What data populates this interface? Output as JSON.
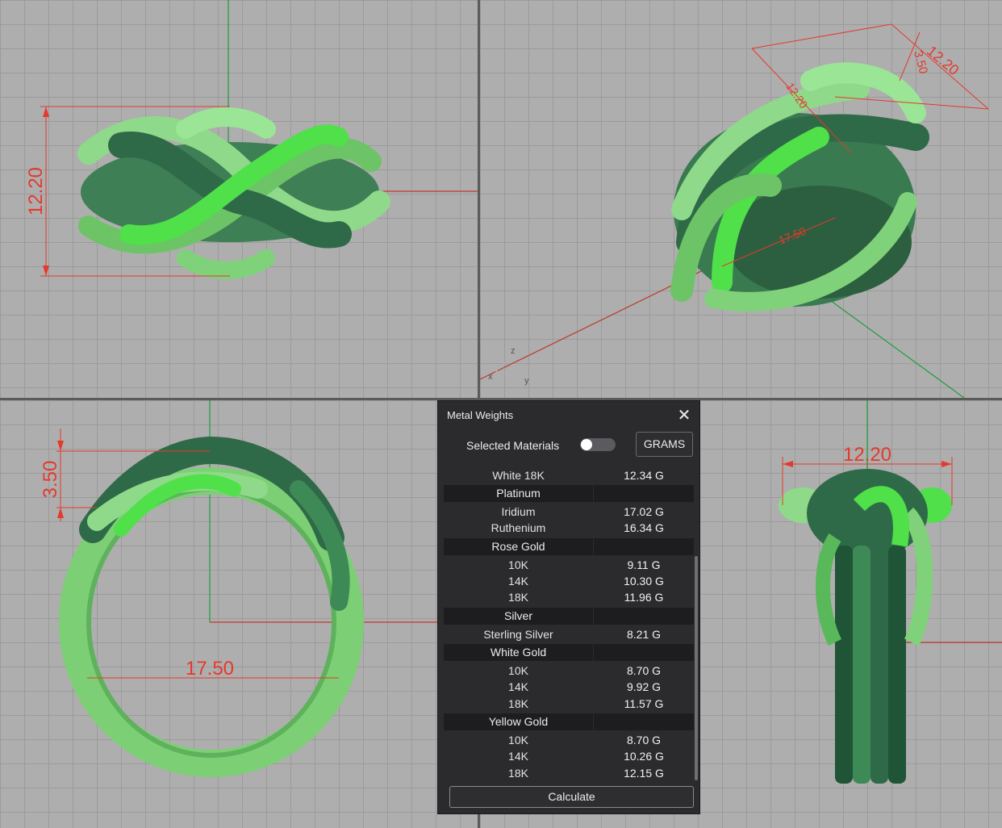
{
  "viewports": {
    "top": {
      "dimension_label": "12.20"
    },
    "perspective": {
      "dimension_labels": [
        "12.20",
        "3.50",
        "12.20",
        "17.50"
      ],
      "axis_labels": {
        "z": "z",
        "x": "x",
        "y": "y"
      }
    },
    "front": {
      "height_label": "3.50",
      "width_label": "17.50"
    },
    "right": {
      "dimension_label": "12.20"
    }
  },
  "ring_colors": {
    "dark": "#2f6a48",
    "mid": "#58b85a",
    "light": "#8fd98a",
    "bright": "#4fe04a"
  },
  "dimension_color": "#e4392c",
  "panel": {
    "title": "Metal Weights",
    "close_icon": "close-icon",
    "selected_materials_label": "Selected Materials",
    "selected_materials_on": false,
    "units_button": "GRAMS",
    "rows": [
      {
        "type": "item",
        "name": "White 18K",
        "weight": "12.34 G"
      },
      {
        "type": "group",
        "name": "Platinum",
        "weight": ""
      },
      {
        "type": "item",
        "name": "Iridium",
        "weight": "17.02 G"
      },
      {
        "type": "item",
        "name": "Ruthenium",
        "weight": "16.34 G"
      },
      {
        "type": "group",
        "name": "Rose Gold",
        "weight": ""
      },
      {
        "type": "item",
        "name": "10K",
        "weight": "9.11 G"
      },
      {
        "type": "item",
        "name": "14K",
        "weight": "10.30 G"
      },
      {
        "type": "item",
        "name": "18K",
        "weight": "11.96 G"
      },
      {
        "type": "group",
        "name": "Silver",
        "weight": ""
      },
      {
        "type": "item",
        "name": "Sterling Silver",
        "weight": "8.21 G"
      },
      {
        "type": "group",
        "name": "White Gold",
        "weight": ""
      },
      {
        "type": "item",
        "name": "10K",
        "weight": "8.70 G"
      },
      {
        "type": "item",
        "name": "14K",
        "weight": "9.92 G"
      },
      {
        "type": "item",
        "name": "18K",
        "weight": "11.57 G"
      },
      {
        "type": "group",
        "name": "Yellow Gold",
        "weight": ""
      },
      {
        "type": "item",
        "name": "10K",
        "weight": "8.70 G"
      },
      {
        "type": "item",
        "name": "14K",
        "weight": "10.26 G"
      },
      {
        "type": "item",
        "name": "18K",
        "weight": "12.15 G"
      }
    ],
    "calculate_button": "Calculate"
  }
}
